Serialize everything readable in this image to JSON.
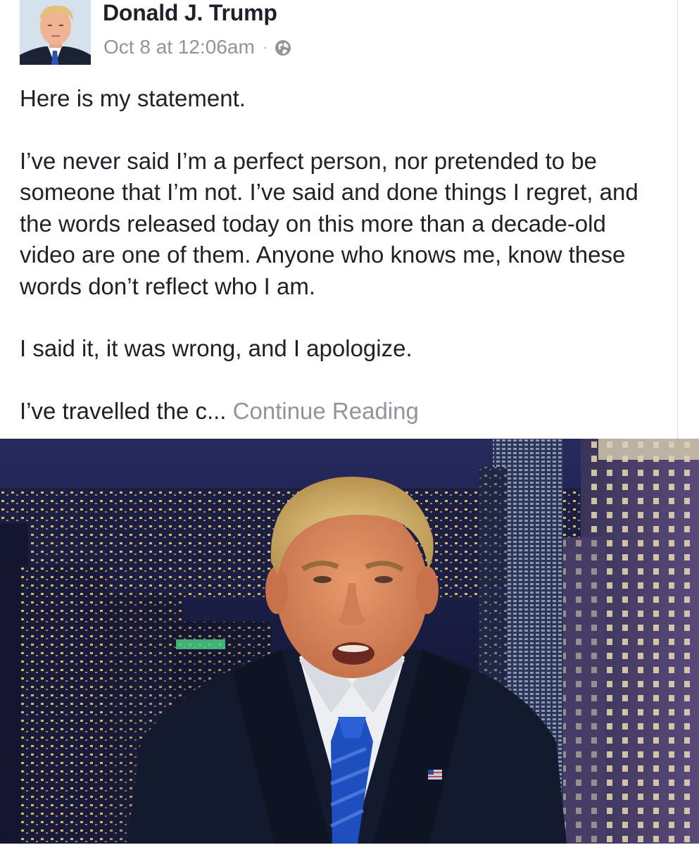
{
  "post": {
    "author": "Donald J. Trump",
    "timestamp": "Oct 8 at 12:06am",
    "separator": "·",
    "privacy_icon": "globe-icon",
    "paragraphs": [
      "Here is my statement.",
      "I’ve never said I’m a perfect person, nor pretended to be someone that I’m not.  I’ve said and done things I regret, and the words released today on this more than a decade-old video are one of them.  Anyone who knows me, know these words don’t reflect who I am.",
      "I said it, it was wrong, and I apologize."
    ],
    "truncated_text": "I’ve travelled the c...",
    "continue_label": "Continue Reading"
  },
  "colors": {
    "text": "#1d2129",
    "secondary": "#90949c",
    "suit": "#141a2e",
    "tie": "#1f4fbf",
    "skyline_sky": "#2a2f66"
  }
}
